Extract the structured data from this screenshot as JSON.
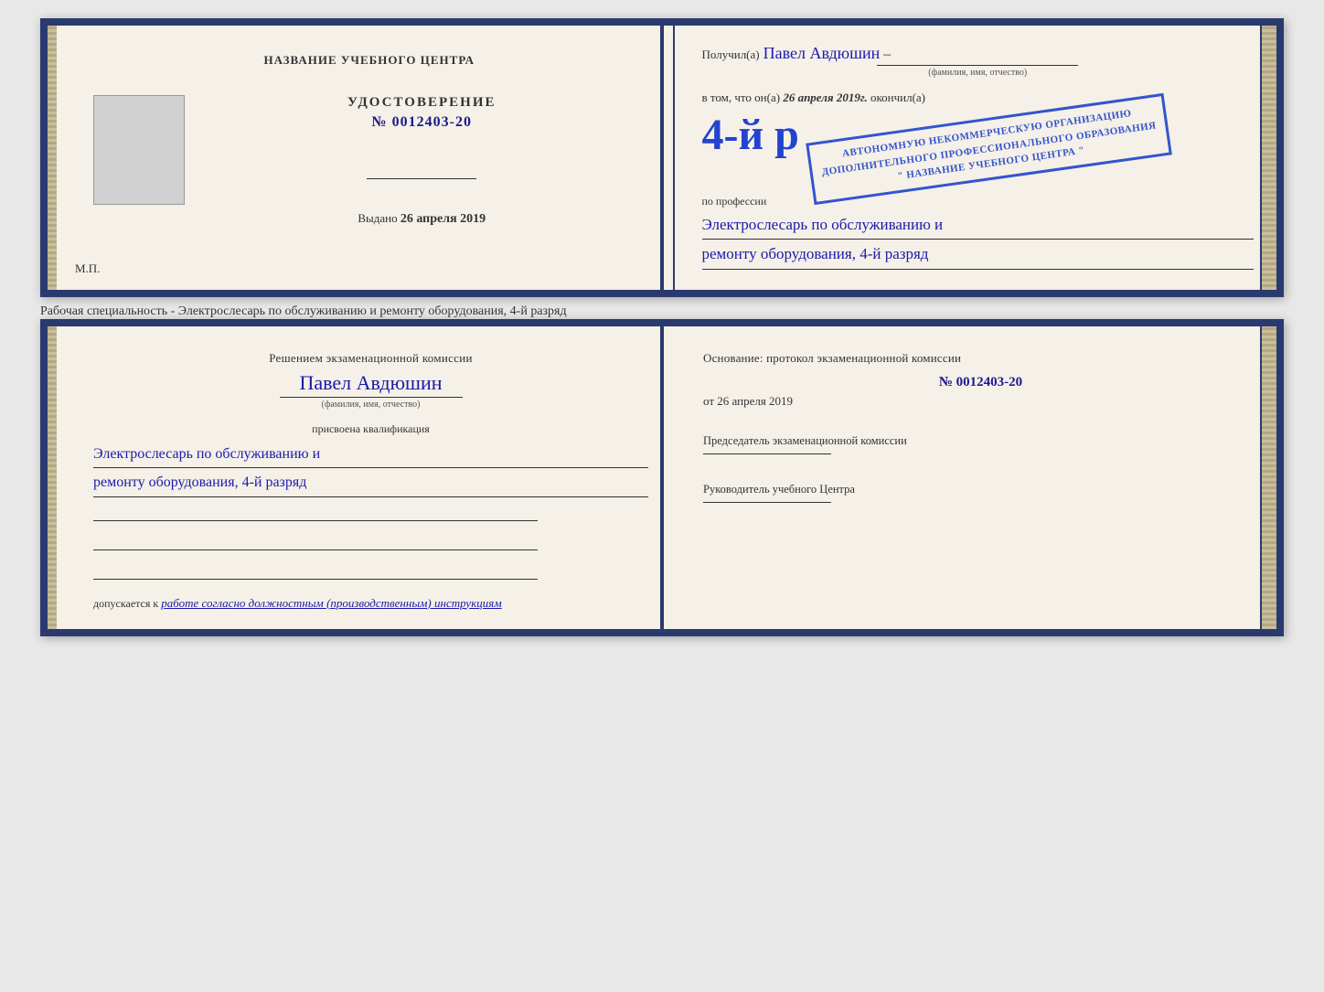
{
  "top_cert": {
    "left": {
      "header": "НАЗВАНИЕ УЧЕБНОГО ЦЕНТРА",
      "doc_type": "УДОСТОВЕРЕНИЕ",
      "doc_number_prefix": "№",
      "doc_number": "0012403-20",
      "issued_label": "Выдано",
      "issued_date": "26 апреля 2019",
      "mp_label": "М.П."
    },
    "right": {
      "received_label": "Получил(а)",
      "recipient_name": "Павел Авдюшин",
      "fio_hint": "(фамилия, имя, отчество)",
      "v_tom_chto": "в том, что он(а)",
      "date_italic": "26 апреля 2019г.",
      "okonchil": "окончил(а)",
      "grade_label": "4-й р",
      "org_line1": "АВТОНОМНУЮ НЕКОММЕРЧЕСКУЮ ОРГАНИЗАЦИЮ",
      "org_line2": "ДОПОЛНИТЕЛЬНОГО ПРОФЕССИОНАЛЬНОГО ОБРАЗОВАНИЯ",
      "org_name": "\" НАЗВАНИЕ УЧЕБНОГО ЦЕНТРА \"",
      "po_professii": "по профессии",
      "profession_line1": "Электрослесарь по обслуживанию и",
      "profession_line2": "ремонту оборудования, 4-й разряд",
      "stamp_line1": "АВТОНОМНУЮ НЕКОММЕРЧЕСКУЮ ОРГАНИЗАЦИЮ",
      "stamp_line2": "ДОПОЛНИТЕЛЬНОГО ПРОФЕССИОНАЛЬНОГО ОБРАЗОВАНИЯ",
      "stamp_line3": "\" НАЗВАНИЕ УЧЕБНОГО ЦЕНТРА \""
    }
  },
  "specialty_label": "Рабочая специальность - Электрослесарь по обслуживанию и ремонту оборудования, 4-й разряд",
  "bottom_cert": {
    "left": {
      "heading": "Решением экзаменационной комиссии",
      "name": "Павел Авдюшин",
      "fio_hint": "(фамилия, имя, отчество)",
      "prisvoena": "присвоена квалификация",
      "qual_line1": "Электрослесарь по обслуживанию и",
      "qual_line2": "ремонту оборудования, 4-й разряд",
      "допускается": "допускается к",
      "work_desc": "работе согласно должностным (производственным) инструкциям"
    },
    "right": {
      "osnov_label": "Основание: протокол экзаменационной комиссии",
      "number_prefix": "№",
      "number": "0012403-20",
      "ot_prefix": "от",
      "date": "26 апреля 2019",
      "chairman_title": "Председатель экзаменационной комиссии",
      "director_title": "Руководитель учебного Центра"
    }
  }
}
